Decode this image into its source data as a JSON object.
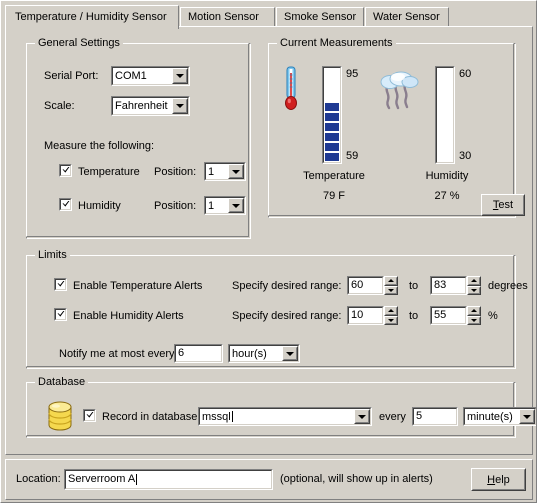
{
  "tabs": [
    {
      "label": "Temperature / Humidity Sensor",
      "active": true
    },
    {
      "label": "Motion Sensor",
      "active": false
    },
    {
      "label": "Smoke Sensor",
      "active": false
    },
    {
      "label": "Water Sensor",
      "active": false
    }
  ],
  "general_settings": {
    "title": "General Settings",
    "serial_port_label": "Serial Port:",
    "serial_port_value": "COM1",
    "scale_label": "Scale:",
    "scale_value": "Fahrenheit",
    "measure_label": "Measure the following:",
    "temperature_label": "Temperature",
    "temperature_checked": true,
    "temperature_position_label": "Position:",
    "temperature_position_value": "1",
    "humidity_label": "Humidity",
    "humidity_checked": true,
    "humidity_position_label": "Position:",
    "humidity_position_value": "1"
  },
  "current_measurements": {
    "title": "Current Measurements",
    "temperature": {
      "caption": "Temperature",
      "max_label": "95",
      "min_label": "59",
      "reading": "79 F",
      "segments_filled": 6,
      "segments_total": 13,
      "fill_color": "#1f3a93"
    },
    "humidity": {
      "caption": "Humidity",
      "max_label": "60",
      "min_label": "30",
      "reading": "27 %",
      "segments_filled": 0,
      "segments_total": 13,
      "fill_color": "#1f3a93"
    },
    "test_button": "Test",
    "test_button_accel": "T"
  },
  "limits": {
    "title": "Limits",
    "enable_temperature_alerts_label": "Enable Temperature Alerts",
    "enable_temperature_alerts_checked": true,
    "enable_humidity_alerts_label": "Enable Humidity Alerts",
    "enable_humidity_alerts_checked": true,
    "temp_range_label": "Specify desired range:",
    "temp_range_min": "60",
    "temp_range_to": "to",
    "temp_range_max": "83",
    "temp_range_unit": "degrees",
    "hum_range_label": "Specify desired range:",
    "hum_range_min": "10",
    "hum_range_to": "to",
    "hum_range_max": "55",
    "hum_range_unit": "%",
    "notify_label": "Notify me at most every",
    "notify_value": "6",
    "notify_unit": "hour(s)"
  },
  "database": {
    "title": "Database",
    "record_label": "Record in database:",
    "record_checked": true,
    "connection_value": "mssql",
    "every_label": "every",
    "interval_value": "5",
    "interval_unit": "minute(s)"
  },
  "footer": {
    "location_label": "Location:",
    "location_value": "Serverroom A",
    "hint": "(optional, will show up in alerts)",
    "help_button": "Help",
    "help_button_accel": "H"
  },
  "colors": {
    "face": "#d4d0c8",
    "gauge_fill": "#1f3a93",
    "db_icon": "#f2d34b",
    "thermo_tube": "#4aa8e0",
    "thermo_bulb": "#d02020"
  }
}
